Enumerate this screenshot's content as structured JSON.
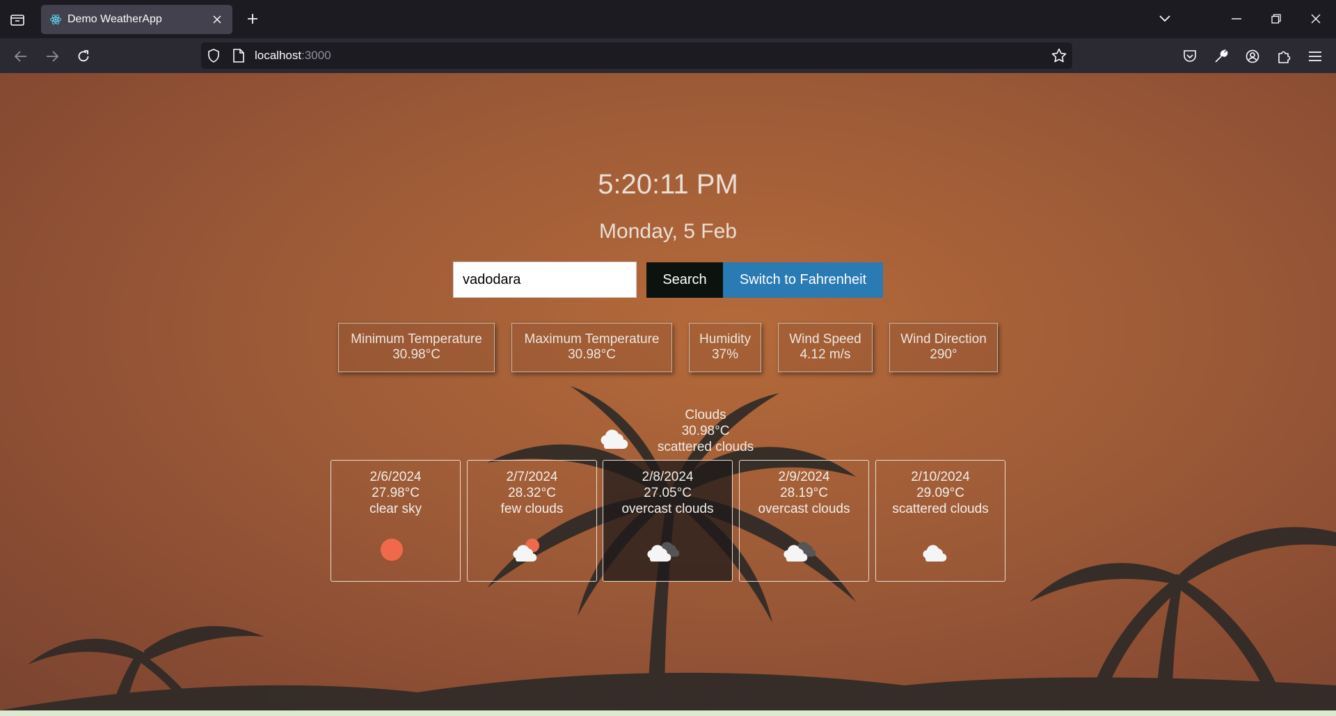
{
  "browser": {
    "tab_title": "Demo WeatherApp",
    "url_host": "localhost",
    "url_port": ":3000"
  },
  "app": {
    "time": "5:20:11 PM",
    "date": "Monday, 5 Feb",
    "search": {
      "value": "vadodara",
      "button": "Search"
    },
    "switch_button": "Switch to Fahrenheit",
    "stats": [
      {
        "label": "Minimum Temperature",
        "value": "30.98°C"
      },
      {
        "label": "Maximum Temperature",
        "value": "30.98°C"
      },
      {
        "label": "Humidity",
        "value": "37%"
      },
      {
        "label": "Wind Speed",
        "value": "4.12 m/s"
      },
      {
        "label": "Wind Direction",
        "value": "290°"
      }
    ],
    "current": {
      "main": "Clouds",
      "temp": "30.98°C",
      "description": "scattered clouds",
      "icon": "cloud-icon"
    },
    "forecast": [
      {
        "date": "2/6/2024",
        "temp": "27.98°C",
        "description": "clear sky",
        "icon": "sun-icon"
      },
      {
        "date": "2/7/2024",
        "temp": "28.32°C",
        "description": "few clouds",
        "icon": "cloud-sun-icon"
      },
      {
        "date": "2/8/2024",
        "temp": "27.05°C",
        "description": "overcast clouds",
        "icon": "overcast-cloud-icon"
      },
      {
        "date": "2/9/2024",
        "temp": "28.19°C",
        "description": "overcast clouds",
        "icon": "overcast-cloud-icon"
      },
      {
        "date": "2/10/2024",
        "temp": "29.09°C",
        "description": "scattered clouds",
        "icon": "cloud-icon"
      }
    ]
  },
  "colors": {
    "background": "#9c5a37",
    "search_button": "#0c130f",
    "switch_button": "#2a7ab3",
    "sun": "#ef6a4c"
  }
}
